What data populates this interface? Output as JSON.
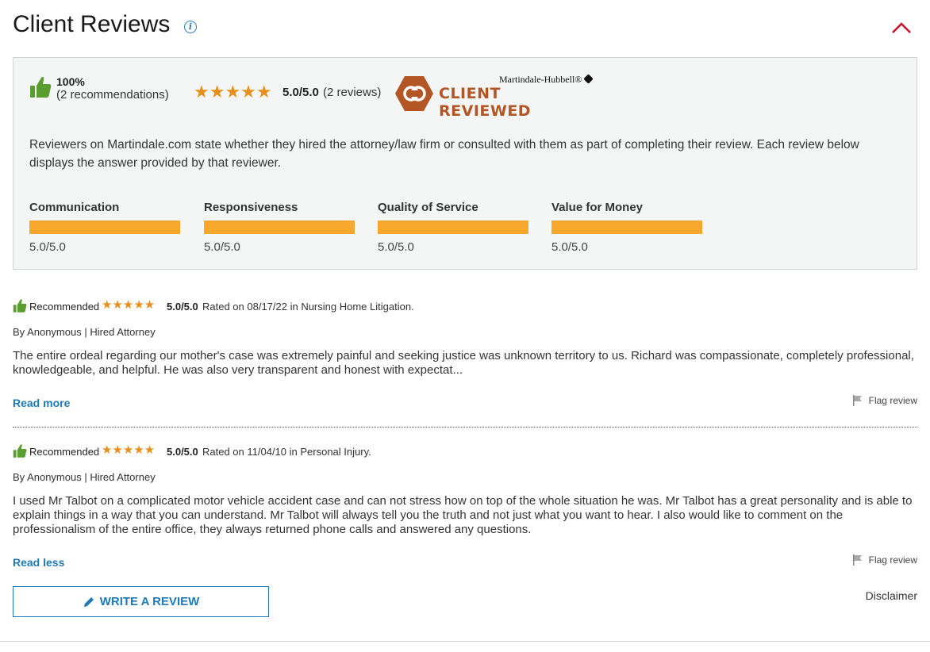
{
  "header": {
    "title": "Client Reviews",
    "info_icon": "info-icon",
    "collapse_icon": "chevron-up-icon"
  },
  "summary": {
    "recommend_percent": "100%",
    "recommend_count": "(2 recommendations)",
    "stars": "★★★★★",
    "score": "5.0/5.0",
    "review_count": "(2 reviews)",
    "badge_brand": "Martindale-Hubbell®",
    "badge_text": "CLIENT REVIEWED",
    "description": "Reviewers on Martindale.com state whether they hired the attorney/law firm or consulted with them as part of completing their review. Each review below displays the answer provided by that reviewer.",
    "metrics": [
      {
        "label": "Communication",
        "score": "5.0/5.0",
        "fraction": 1.0
      },
      {
        "label": "Responsiveness",
        "score": "5.0/5.0",
        "fraction": 1.0
      },
      {
        "label": "Quality of Service",
        "score": "5.0/5.0",
        "fraction": 1.0
      },
      {
        "label": "Value for Money",
        "score": "5.0/5.0",
        "fraction": 1.0
      }
    ]
  },
  "reviews": [
    {
      "recommended": "Recommended",
      "stars": "★★★★★",
      "score": "5.0/5.0",
      "meta": "Rated on 08/17/22 in Nursing Home Litigation.",
      "by": "By Anonymous | Hired Attorney",
      "text": "The entire ordeal regarding our mother's case was extremely painful and seeking justice was unknown territory to us. Richard was compassionate, completely professional, knowledgeable, and helpful. He was also very transparent and honest with expectat...",
      "toggle": "Read more",
      "flag": "Flag review"
    },
    {
      "recommended": "Recommended",
      "stars": "★★★★★",
      "score": "5.0/5.0",
      "meta": "Rated on 11/04/10 in Personal Injury.",
      "by": "By Anonymous | Hired Attorney",
      "text": "I used Mr Talbot on a complicated motor vehicle accident case and can not stress how on top of the whole situation he was. Mr Talbot has a great personality and is able to explain things in a way that you can understand. Mr Talbot will always tell you the truth and not just what you want to hear. I also would like to comment on the professionalism of the entire office, they always returned phone calls and answered any questions.",
      "toggle": "Read less",
      "flag": "Flag review"
    }
  ],
  "footer": {
    "write_review": "WRITE A REVIEW",
    "disclaimer": "Disclaimer"
  },
  "colors": {
    "accent": "#1f7ab8",
    "star": "#e8901b",
    "bar": "#f7a72c",
    "thumb": "#5a9e2f",
    "badge": "#b35524",
    "collapse": "#c8102e"
  }
}
